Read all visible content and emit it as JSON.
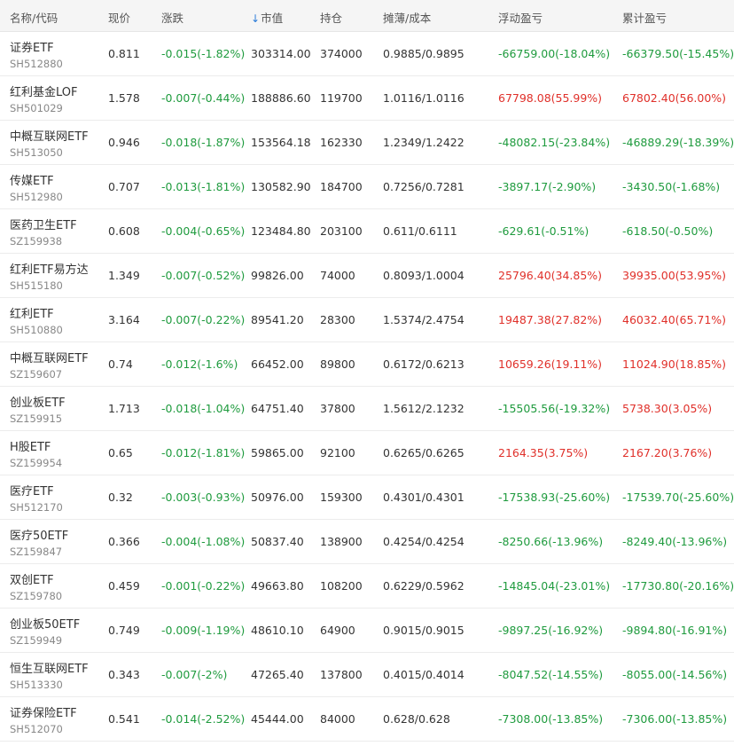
{
  "header": {
    "name_code": "名称/代码",
    "price": "现价",
    "change": "涨跌",
    "sort_arrow": "↓",
    "market_value": "市值",
    "holding": "持仓",
    "cost": "摊薄/成本",
    "float_pnl": "浮动盈亏",
    "total_pnl": "累计盈亏"
  },
  "colors": {
    "gain": "#e0302a",
    "loss": "#1f9b3e",
    "sort_accent": "#2a7bd8"
  },
  "rows": [
    {
      "name": "证券ETF",
      "code": "SH512880",
      "price": "0.811",
      "change": "-0.015(-1.82%)",
      "mv": "303314.00",
      "hold": "374000",
      "cost": "0.9885/0.9895",
      "float": "-66759.00(-18.04%)",
      "total": "-66379.50(-15.45%)"
    },
    {
      "name": "红利基金LOF",
      "code": "SH501029",
      "price": "1.578",
      "change": "-0.007(-0.44%)",
      "mv": "188886.60",
      "hold": "119700",
      "cost": "1.0116/1.0116",
      "float": "67798.08(55.99%)",
      "total": "67802.40(56.00%)"
    },
    {
      "name": "中概互联网ETF",
      "code": "SH513050",
      "price": "0.946",
      "change": "-0.018(-1.87%)",
      "mv": "153564.18",
      "hold": "162330",
      "cost": "1.2349/1.2422",
      "float": "-48082.15(-23.84%)",
      "total": "-46889.29(-18.39%)"
    },
    {
      "name": "传媒ETF",
      "code": "SH512980",
      "price": "0.707",
      "change": "-0.013(-1.81%)",
      "mv": "130582.90",
      "hold": "184700",
      "cost": "0.7256/0.7281",
      "float": "-3897.17(-2.90%)",
      "total": "-3430.50(-1.68%)"
    },
    {
      "name": "医药卫生ETF",
      "code": "SZ159938",
      "price": "0.608",
      "change": "-0.004(-0.65%)",
      "mv": "123484.80",
      "hold": "203100",
      "cost": "0.611/0.6111",
      "float": "-629.61(-0.51%)",
      "total": "-618.50(-0.50%)"
    },
    {
      "name": "红利ETF易方达",
      "code": "SH515180",
      "price": "1.349",
      "change": "-0.007(-0.52%)",
      "mv": "99826.00",
      "hold": "74000",
      "cost": "0.8093/1.0004",
      "float": "25796.40(34.85%)",
      "total": "39935.00(53.95%)"
    },
    {
      "name": "红利ETF",
      "code": "SH510880",
      "price": "3.164",
      "change": "-0.007(-0.22%)",
      "mv": "89541.20",
      "hold": "28300",
      "cost": "1.5374/2.4754",
      "float": "19487.38(27.82%)",
      "total": "46032.40(65.71%)"
    },
    {
      "name": "中概互联网ETF",
      "code": "SZ159607",
      "price": "0.74",
      "change": "-0.012(-1.6%)",
      "mv": "66452.00",
      "hold": "89800",
      "cost": "0.6172/0.6213",
      "float": "10659.26(19.11%)",
      "total": "11024.90(18.85%)"
    },
    {
      "name": "创业板ETF",
      "code": "SZ159915",
      "price": "1.713",
      "change": "-0.018(-1.04%)",
      "mv": "64751.40",
      "hold": "37800",
      "cost": "1.5612/2.1232",
      "float": "-15505.56(-19.32%)",
      "total": "5738.30(3.05%)"
    },
    {
      "name": "H股ETF",
      "code": "SZ159954",
      "price": "0.65",
      "change": "-0.012(-1.81%)",
      "mv": "59865.00",
      "hold": "92100",
      "cost": "0.6265/0.6265",
      "float": "2164.35(3.75%)",
      "total": "2167.20(3.76%)"
    },
    {
      "name": "医疗ETF",
      "code": "SH512170",
      "price": "0.32",
      "change": "-0.003(-0.93%)",
      "mv": "50976.00",
      "hold": "159300",
      "cost": "0.4301/0.4301",
      "float": "-17538.93(-25.60%)",
      "total": "-17539.70(-25.60%)"
    },
    {
      "name": "医疗50ETF",
      "code": "SZ159847",
      "price": "0.366",
      "change": "-0.004(-1.08%)",
      "mv": "50837.40",
      "hold": "138900",
      "cost": "0.4254/0.4254",
      "float": "-8250.66(-13.96%)",
      "total": "-8249.40(-13.96%)"
    },
    {
      "name": "双创ETF",
      "code": "SZ159780",
      "price": "0.459",
      "change": "-0.001(-0.22%)",
      "mv": "49663.80",
      "hold": "108200",
      "cost": "0.6229/0.5962",
      "float": "-14845.04(-23.01%)",
      "total": "-17730.80(-20.16%)"
    },
    {
      "name": "创业板50ETF",
      "code": "SZ159949",
      "price": "0.749",
      "change": "-0.009(-1.19%)",
      "mv": "48610.10",
      "hold": "64900",
      "cost": "0.9015/0.9015",
      "float": "-9897.25(-16.92%)",
      "total": "-9894.80(-16.91%)"
    },
    {
      "name": "恒生互联网ETF",
      "code": "SH513330",
      "price": "0.343",
      "change": "-0.007(-2%)",
      "mv": "47265.40",
      "hold": "137800",
      "cost": "0.4015/0.4014",
      "float": "-8047.52(-14.55%)",
      "total": "-8055.00(-14.56%)"
    },
    {
      "name": "证券保险ETF",
      "code": "SH512070",
      "price": "0.541",
      "change": "-0.014(-2.52%)",
      "mv": "45444.00",
      "hold": "84000",
      "cost": "0.628/0.628",
      "float": "-7308.00(-13.85%)",
      "total": "-7306.00(-13.85%)"
    }
  ]
}
